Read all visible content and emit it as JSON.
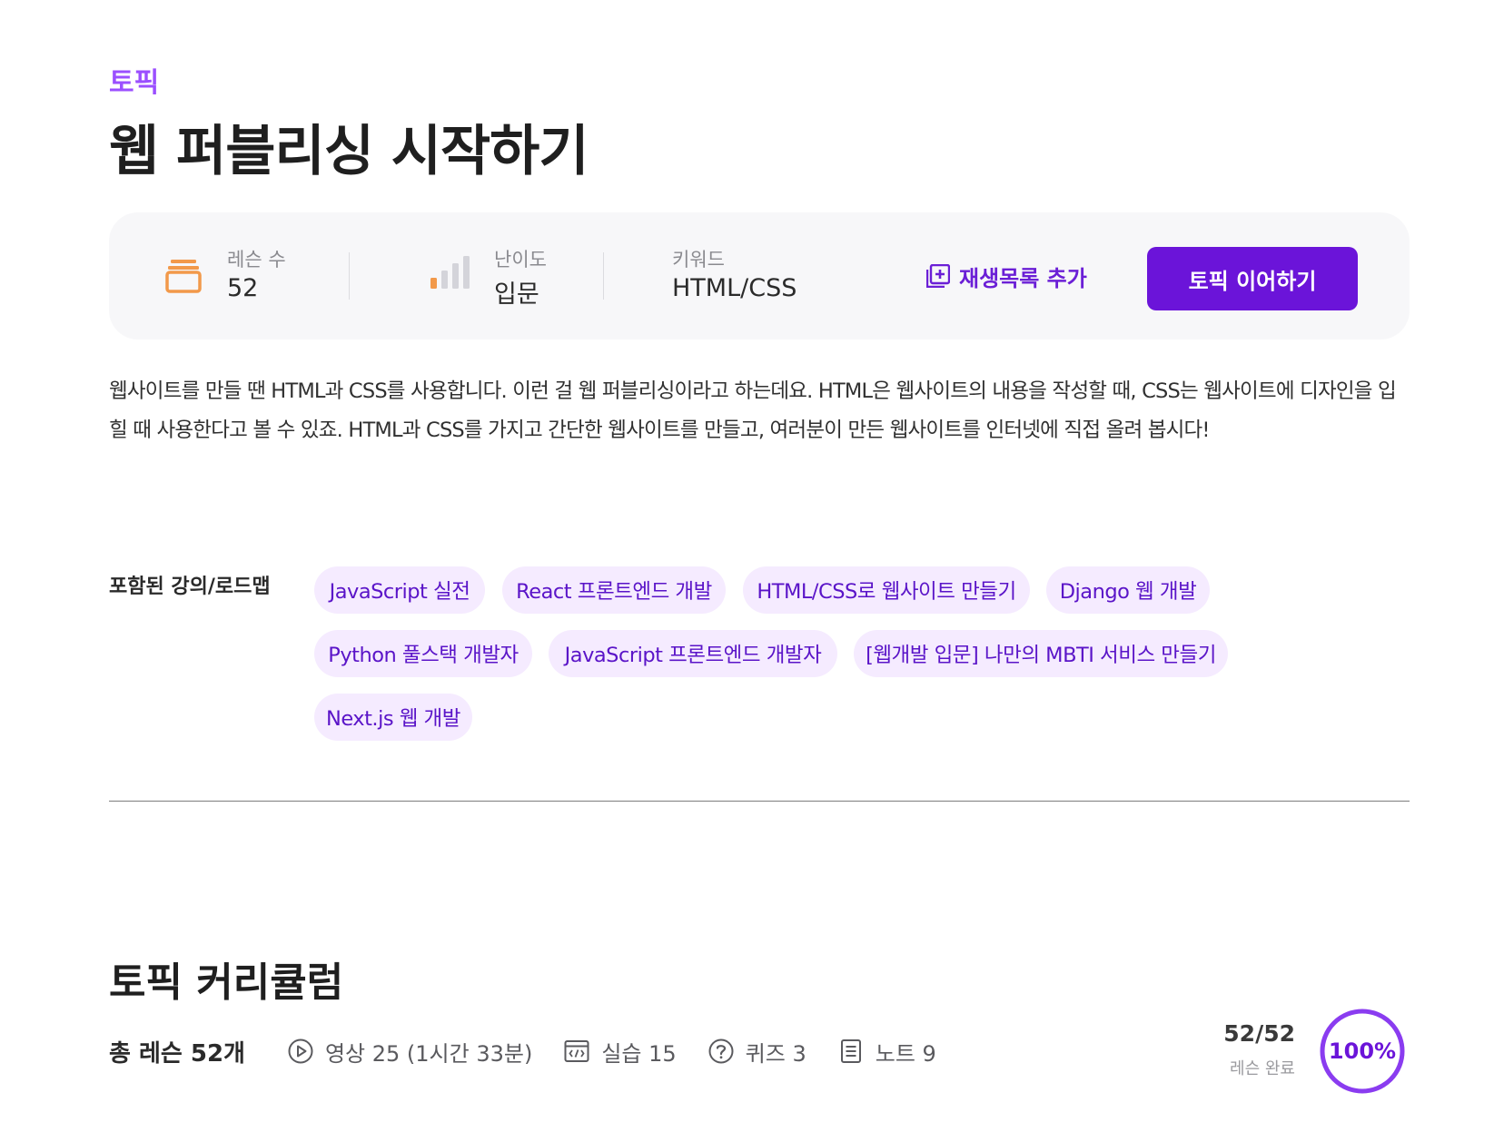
{
  "header": {
    "eyebrow": "토픽",
    "title": "웹 퍼블리싱 시작하기"
  },
  "stats": {
    "lessons": {
      "label": "레슨 수",
      "value": "52",
      "icon": "stacked-cards-icon"
    },
    "difficulty": {
      "label": "난이도",
      "value": "입문",
      "icon": "signal-bars-icon",
      "level_fraction": 0.25
    },
    "keyword": {
      "label": "키워드",
      "value": "HTML/CSS"
    }
  },
  "actions": {
    "playlist_label": "재생목록 추가",
    "playlist_icon": "playlist-add-icon",
    "continue_label": "토픽 이어하기"
  },
  "description": "웹사이트를 만들 땐 HTML과 CSS를 사용합니다. 이런 걸 웹 퍼블리싱이라고 하는데요. HTML은 웹사이트의 내용을 작성할 때, CSS는 웹사이트에 디자인을 입힐 때 사용한다고 볼 수 있죠. HTML과 CSS를 가지고 간단한 웹사이트를 만들고, 여러분이 만든 웹사이트를 인터넷에 직접 올려 봅시다!",
  "included": {
    "label": "포함된 강의/로드맵",
    "items": [
      "JavaScript 실전",
      "React 프론트엔드 개발",
      "HTML/CSS로 웹사이트 만들기",
      "Django 웹 개발",
      "Python 풀스택 개발자",
      "JavaScript 프론트엔드 개발자",
      "[웹개발 입문] 나만의 MBTI 서비스 만들기",
      "Next.js 웹 개발"
    ]
  },
  "curriculum": {
    "title": "토픽 커리큘럼",
    "total": "총 레슨 52개",
    "meta": [
      {
        "icon": "play-circle-icon",
        "label": "영상 25 (1시간 33분)"
      },
      {
        "icon": "code-window-icon",
        "label": "실습 15"
      },
      {
        "icon": "question-circle-icon",
        "label": "퀴즈 3"
      },
      {
        "icon": "note-icon",
        "label": "노트 9"
      }
    ],
    "progress": {
      "count": "52/52",
      "label": "레슨 완료",
      "percent_text": "100%",
      "fraction": 1.0
    }
  },
  "colors": {
    "accent": "#6B14D9",
    "eyebrow": "#9B4FFF",
    "chip_bg": "#F5EBFF",
    "lessons_icon": "#F2994A"
  }
}
